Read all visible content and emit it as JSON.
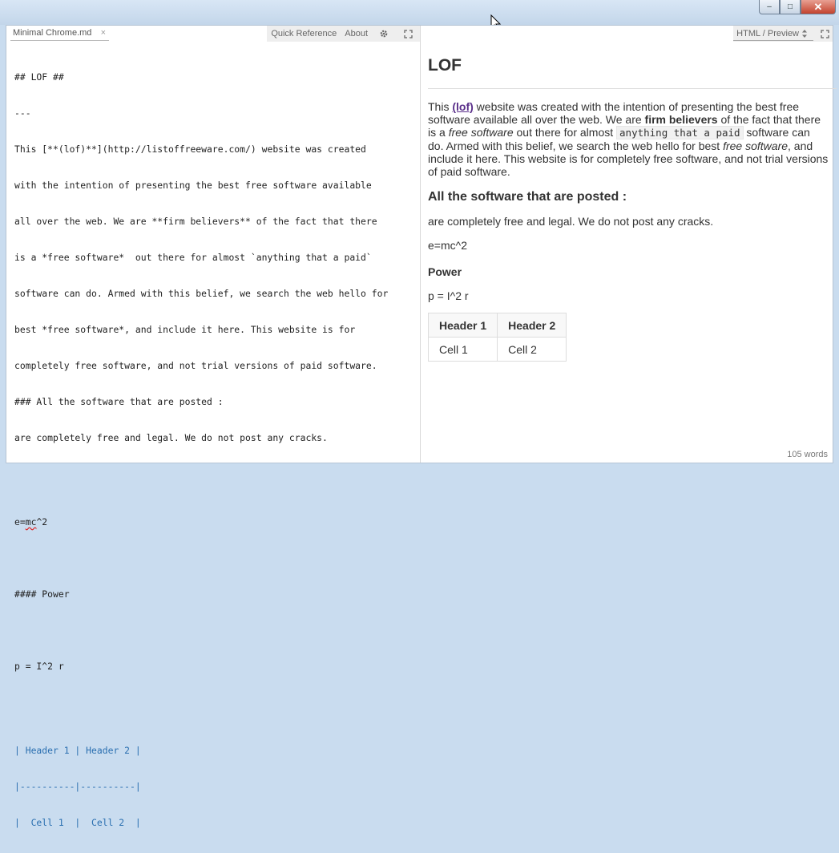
{
  "window": {
    "min_symbol": "–",
    "max_symbol": "□",
    "close_symbol": "✕"
  },
  "editor": {
    "tab_label": "Minimal Chrome.md",
    "tab_close": "×",
    "quick_reference": "Quick Reference",
    "about": "About",
    "lines": {
      "l1": "## LOF ##",
      "l2": "---",
      "l3": "This [**(lof)**](http://listoffreeware.com/) website was created",
      "l4": "with the intention of presenting the best free software available",
      "l5": "all over the web. We are **firm believers** of the fact that there",
      "l6": "is a *free software*  out there for almost `anything that a paid`",
      "l7": "software can do. Armed with this belief, we search the web hello for",
      "l8": "best *free software*, and include it here. This website is for",
      "l9": "completely free software, and not trial versions of paid software.",
      "l10": "### All the software that are posted :",
      "l11": "are completely free and legal. We do not post any cracks.",
      "l12a": "e=",
      "l12b": "mc",
      "l12c": "^2",
      "l13": "#### Power",
      "l14": "p = I^2 r",
      "l15": "| Header 1 | Header 2 |",
      "l16": "|----------|----------|",
      "l17": "|  Cell 1  |  Cell 2  |"
    }
  },
  "preview": {
    "mode_label": "HTML / Preview",
    "h1": "LOF",
    "p1": {
      "t1": "This ",
      "link": "(lof)",
      "t2": " website was created with the intention of presenting the best free software available all over the web. We are ",
      "bold": "firm believers",
      "t3": " of the fact that there is a ",
      "em1": "free software",
      "t4": " out there for almost ",
      "code": "anything that a paid",
      "t5": " software can do. Armed with this belief, we search the web hello for best ",
      "em2": "free software",
      "t6": ", and include it here. This website is for completely free software, and not trial versions of paid software."
    },
    "h3": "All the software that are posted :",
    "p2": "are completely free and legal. We do not post any cracks.",
    "p3": "e=mc^2",
    "h4": "Power",
    "p4": "p = I^2 r",
    "table": {
      "headers": [
        "Header 1",
        "Header 2"
      ],
      "row": [
        "Cell 1",
        "Cell 2"
      ]
    },
    "word_count": "105 words"
  }
}
